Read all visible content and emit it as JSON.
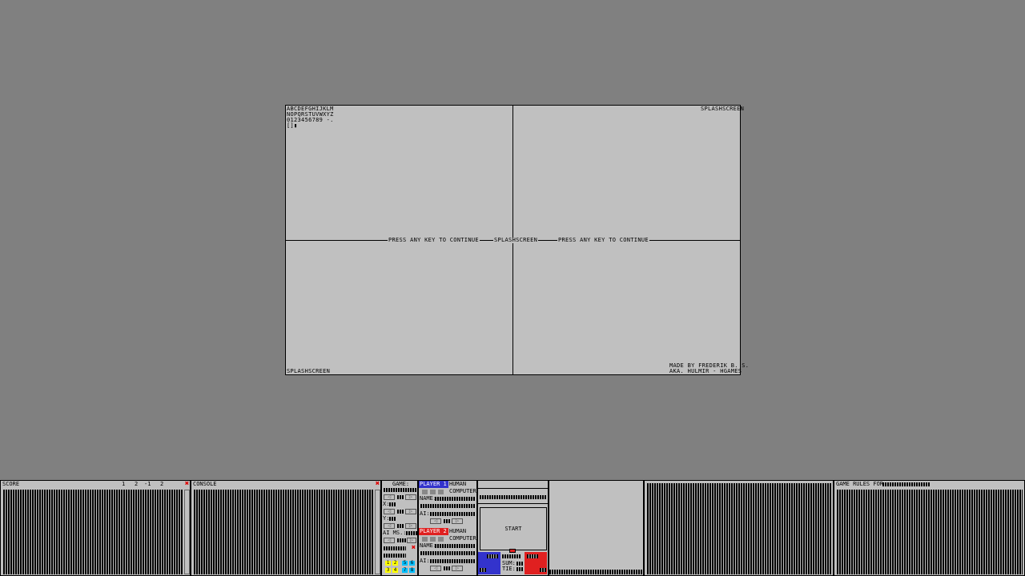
{
  "splash": {
    "charset_line1": "ABCDEFGHIJKLM",
    "charset_line2": "NOPQRSTUVWXYZ",
    "charset_line3": "0123456789 -.",
    "charset_line4": "[]▮",
    "top_right": "SPLASHSCREEN",
    "center": "SPLASHSCREEN",
    "press_left": "PRESS ANY KEY TO CONTINUE",
    "press_right": "PRESS ANY KEY TO CONTINUE",
    "bottom_left": "SPLASHSCREEN",
    "credit_line1": "MADE BY FREDERIK B. S.",
    "credit_line2": "AKA. HULMIR - HGAMES"
  },
  "score_panel": {
    "title": "SCORE",
    "cols": [
      "1",
      "2",
      "-1",
      "2"
    ]
  },
  "console_panel": {
    "title": "CONSOLE"
  },
  "game_panel": {
    "game_label": "GAME:",
    "x_label": "X:",
    "y_label": "Y:",
    "ai_ms_label": "AI MS.:",
    "numbers": [
      "1",
      "2",
      "3",
      "4",
      "5",
      "6",
      "7",
      "8"
    ]
  },
  "player1": {
    "tag": "PLAYER 1",
    "human": "HUMAN",
    "computer": "COMPUTER",
    "name_label": "NAME:",
    "ai_label": "AI:"
  },
  "player2": {
    "tag": "PLAYER 2",
    "human": "HUMAN",
    "computer": "COMPUTER",
    "name_label": "NAME:",
    "ai_label": "AI:"
  },
  "start_panel": {
    "start_label": "START",
    "sum_label": "SUM:",
    "tie_label": "TIE:"
  },
  "rules_panel": {
    "title": "GAME RULES FOR"
  },
  "colors": {
    "player1": "#3333cc",
    "player2": "#e02020",
    "close": "#e00000",
    "yellow": "#ffff00",
    "cyan": "#00c0ff"
  }
}
